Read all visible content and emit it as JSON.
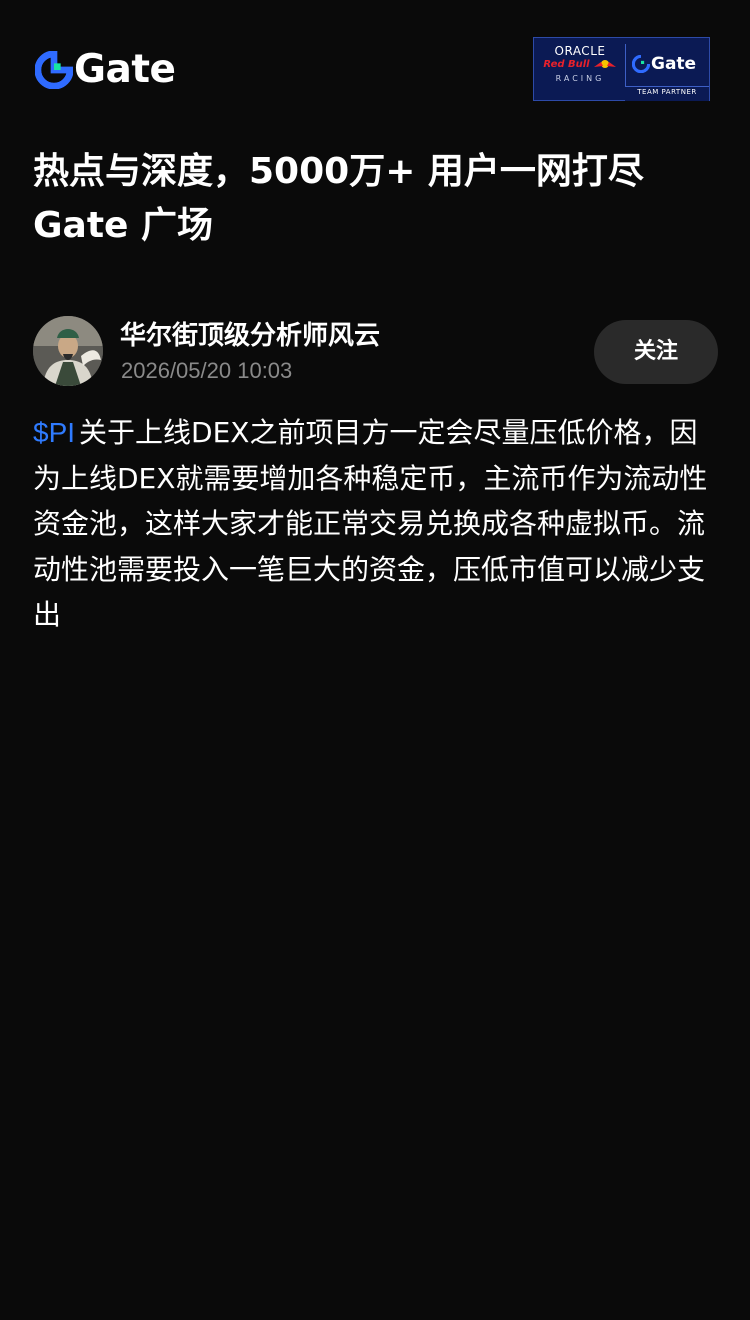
{
  "header": {
    "logo_text": "Gate",
    "partner_badge": {
      "oracle": "ORACLE",
      "redbull": "Red Bull",
      "racing": "RACING",
      "brand": "Gate",
      "caption": "TEAM PARTNER"
    }
  },
  "headline": "热点与深度，5000万+ 用户一网打尽 Gate 广场",
  "post": {
    "author_name": "华尔街顶级分析师风云",
    "timestamp": "2026/05/20 10:03",
    "follow_label": "关注",
    "ticker": "$PI",
    "body": "关于上线DEX之前项目方一定会尽量压低价格，因为上线DEX就需要增加各种稳定币，主流币作为流动性资金池，这样大家才能正常交易兑换成各种虚拟币。流动性池需要投入一笔巨大的资金，压低市值可以减少支出"
  },
  "colors": {
    "background": "#0a0a0a",
    "accent_blue": "#2f7bff",
    "logo_green": "#17e5a1",
    "muted_text": "#8a8a8a",
    "button_bg": "#2a2a2a",
    "partner_bg": "#0b1a54"
  }
}
